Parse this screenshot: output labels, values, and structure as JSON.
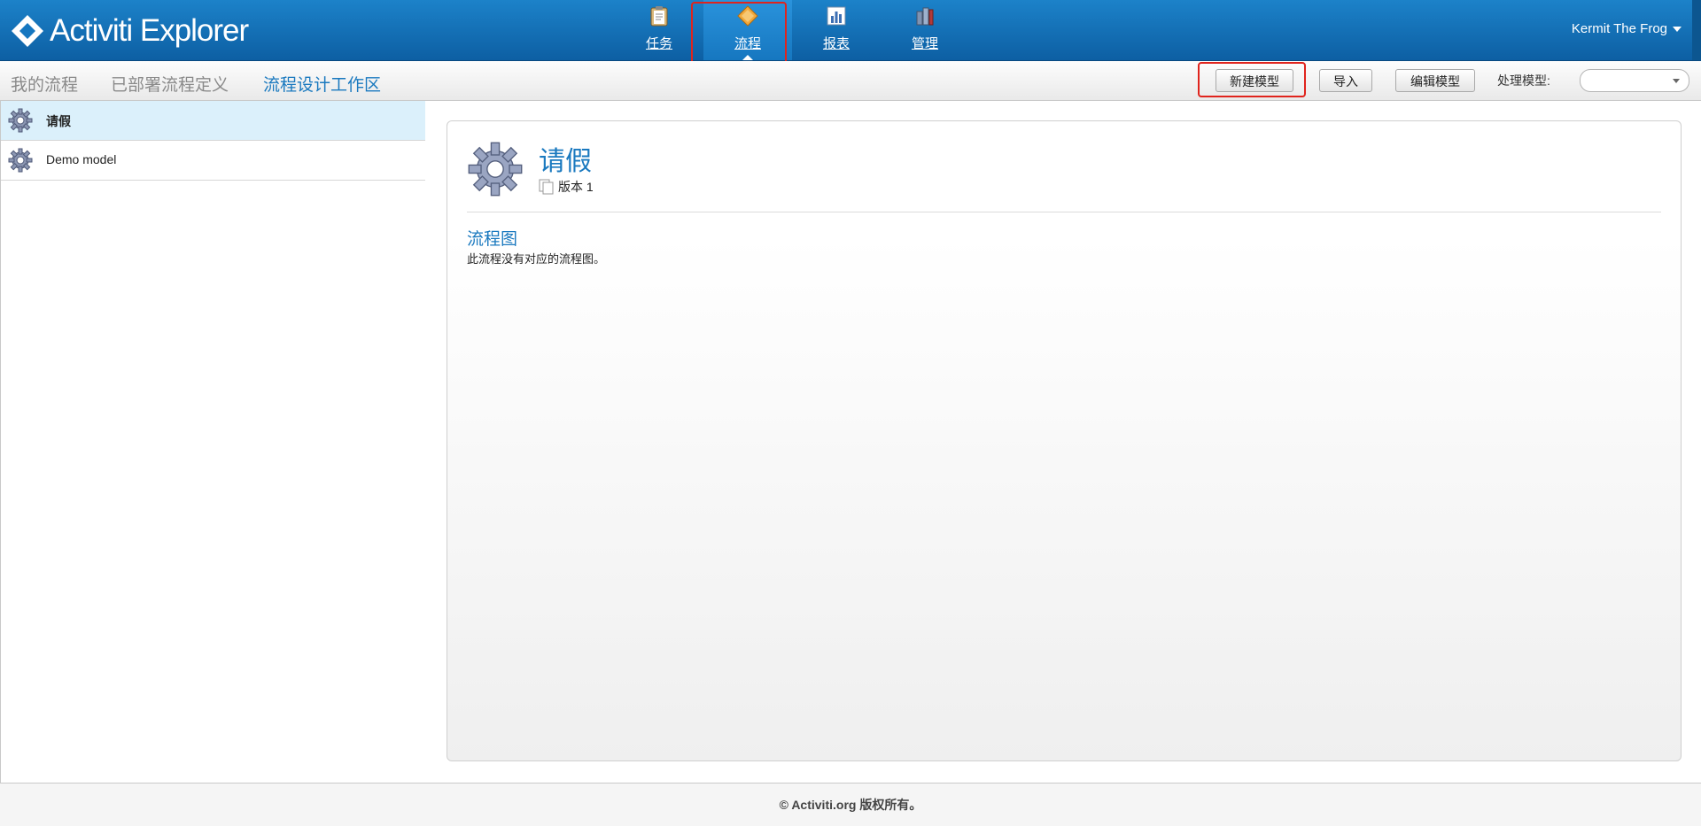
{
  "header": {
    "logo_text": "Activiti Explorer",
    "nav": [
      {
        "label": "任务",
        "icon": "clipboard-icon"
      },
      {
        "label": "流程",
        "icon": "process-diamond-icon",
        "active": true
      },
      {
        "label": "报表",
        "icon": "chart-icon"
      },
      {
        "label": "管理",
        "icon": "admin-books-icon"
      }
    ],
    "user": "Kermit The Frog"
  },
  "subnav": {
    "tabs": [
      {
        "label": "我的流程"
      },
      {
        "label": "已部署流程定义"
      },
      {
        "label": "流程设计工作区",
        "active": true
      }
    ],
    "buttons": {
      "new_model": "新建模型",
      "import": "导入",
      "edit_model": "编辑模型"
    },
    "process_model_label": "处理模型:",
    "process_model_value": ""
  },
  "models": [
    {
      "name": "请假",
      "selected": true
    },
    {
      "name": "Demo model",
      "selected": false
    }
  ],
  "detail": {
    "title": "请假",
    "version": "版本 1",
    "diagram_title": "流程图",
    "diagram_message": "此流程没有对应的流程图。"
  },
  "footer": {
    "text": "© Activiti.org 版权所有。"
  },
  "colors": {
    "header_blue": "#1677c0",
    "accent_blue": "#1a79bf",
    "highlight_red": "#e0241d",
    "selected_row": "#dbf0fb"
  }
}
